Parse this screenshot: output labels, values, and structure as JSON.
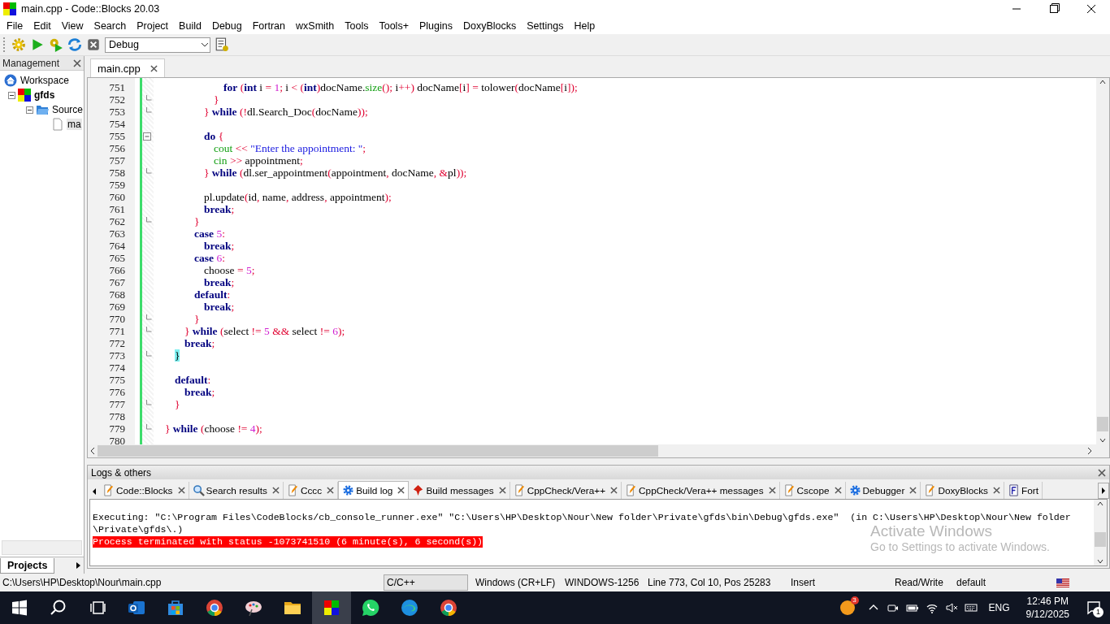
{
  "window": {
    "title": "main.cpp - Code::Blocks 20.03"
  },
  "menu": [
    "File",
    "Edit",
    "View",
    "Search",
    "Project",
    "Build",
    "Debug",
    "Fortran",
    "wxSmith",
    "Tools",
    "Tools+",
    "Plugins",
    "DoxyBlocks",
    "Settings",
    "Help"
  ],
  "toolbar": {
    "build_target": "Debug"
  },
  "management": {
    "title": "Management",
    "tree": [
      {
        "label": "Workspace",
        "kind": "workspace",
        "active": false,
        "selected": false,
        "children": [
          {
            "label": "gfds",
            "kind": "project",
            "active": true,
            "selected": false,
            "expanded": true,
            "children": [
              {
                "label": "Source",
                "kind": "folder",
                "active": false,
                "selected": false,
                "expanded": true,
                "children": [
                  {
                    "label": "ma",
                    "kind": "file",
                    "active": false,
                    "selected": true
                  }
                ]
              }
            ]
          }
        ]
      }
    ],
    "tabs": [
      {
        "label": "Projects",
        "selected": true
      }
    ]
  },
  "editor": {
    "tabs": [
      {
        "label": "main.cpp",
        "selected": true
      }
    ],
    "lines": [
      {
        "number": "751",
        "kind": "plain",
        "tokens": [
          {
            "kind": "kw",
            "text": "\t\t\t\t\t\tfor"
          },
          {
            "kind": "op",
            "text": " ("
          },
          {
            "kind": "kw",
            "text": "int"
          },
          {
            "kind": "id",
            "text": " i "
          },
          {
            "kind": "op",
            "text": "="
          },
          {
            "kind": "num",
            "text": " 1"
          },
          {
            "kind": "op",
            "text": ";"
          },
          {
            "kind": "id",
            "text": " i "
          },
          {
            "kind": "op",
            "text": "< ("
          },
          {
            "kind": "kw",
            "text": "int"
          },
          {
            "kind": "op",
            "text": ")"
          },
          {
            "kind": "id",
            "text": "docName."
          },
          {
            "kind": "lib",
            "text": "size"
          },
          {
            "kind": "op",
            "text": "();"
          },
          {
            "kind": "id",
            "text": " i"
          },
          {
            "kind": "op",
            "text": "++)"
          },
          {
            "kind": "id",
            "text": " docName"
          },
          {
            "kind": "op",
            "text": "["
          },
          {
            "kind": "id",
            "text": "i"
          },
          {
            "kind": "op",
            "text": "] ="
          },
          {
            "kind": "id",
            "text": " tolower"
          },
          {
            "kind": "op",
            "text": "("
          },
          {
            "kind": "id",
            "text": "docName"
          },
          {
            "kind": "op",
            "text": "["
          },
          {
            "kind": "id",
            "text": "i"
          },
          {
            "kind": "op",
            "text": "]);"
          }
        ]
      },
      {
        "number": "752",
        "kind": "fold-end",
        "tokens": [
          {
            "kind": "op",
            "text": "\t\t\t\t\t}"
          }
        ]
      },
      {
        "number": "753",
        "kind": "fold-end",
        "tokens": [
          {
            "kind": "op",
            "text": "\t\t\t\t}"
          },
          {
            "kind": "kw",
            "text": " while"
          },
          {
            "kind": "op",
            "text": " (!"
          },
          {
            "kind": "id",
            "text": "dl.Search_Doc"
          },
          {
            "kind": "op",
            "text": "("
          },
          {
            "kind": "id",
            "text": "docName"
          },
          {
            "kind": "op",
            "text": "));"
          }
        ]
      },
      {
        "number": "754",
        "kind": "plain"
      },
      {
        "number": "755",
        "kind": "fold-start",
        "tokens": [
          {
            "kind": "kw",
            "text": "\t\t\t\tdo"
          },
          {
            "kind": "op",
            "text": " {"
          }
        ]
      },
      {
        "number": "756",
        "kind": "plain",
        "tokens": [
          {
            "kind": "lib",
            "text": "\t\t\t\t\tcout"
          },
          {
            "kind": "op",
            "text": " <<"
          },
          {
            "kind": "str",
            "text": " \"Enter the appointment: \""
          },
          {
            "kind": "op",
            "text": ";"
          }
        ]
      },
      {
        "number": "757",
        "kind": "plain",
        "tokens": [
          {
            "kind": "lib",
            "text": "\t\t\t\t\tcin"
          },
          {
            "kind": "op",
            "text": " >>"
          },
          {
            "kind": "id",
            "text": " appointment"
          },
          {
            "kind": "op",
            "text": ";"
          }
        ]
      },
      {
        "number": "758",
        "kind": "fold-end",
        "tokens": [
          {
            "kind": "op",
            "text": "\t\t\t\t}"
          },
          {
            "kind": "kw",
            "text": " while"
          },
          {
            "kind": "op",
            "text": " ("
          },
          {
            "kind": "id",
            "text": "dl.ser_appointment"
          },
          {
            "kind": "op",
            "text": "("
          },
          {
            "kind": "id",
            "text": "appointment"
          },
          {
            "kind": "op",
            "text": ","
          },
          {
            "kind": "id",
            "text": " docName"
          },
          {
            "kind": "op",
            "text": ", &"
          },
          {
            "kind": "id",
            "text": "pl"
          },
          {
            "kind": "op",
            "text": "));"
          }
        ]
      },
      {
        "number": "759",
        "kind": "plain"
      },
      {
        "number": "760",
        "kind": "plain",
        "tokens": [
          {
            "kind": "id",
            "text": "\t\t\t\tpl.update"
          },
          {
            "kind": "op",
            "text": "("
          },
          {
            "kind": "id",
            "text": "id"
          },
          {
            "kind": "op",
            "text": ","
          },
          {
            "kind": "id",
            "text": " name"
          },
          {
            "kind": "op",
            "text": ","
          },
          {
            "kind": "id",
            "text": " address"
          },
          {
            "kind": "op",
            "text": ","
          },
          {
            "kind": "id",
            "text": " appointment"
          },
          {
            "kind": "op",
            "text": ");"
          }
        ]
      },
      {
        "number": "761",
        "kind": "plain",
        "tokens": [
          {
            "kind": "kw",
            "text": "\t\t\t\tbreak"
          },
          {
            "kind": "op",
            "text": ";"
          }
        ]
      },
      {
        "number": "762",
        "kind": "fold-end",
        "tokens": [
          {
            "kind": "op",
            "text": "\t\t\t}"
          }
        ]
      },
      {
        "number": "763",
        "kind": "plain",
        "tokens": [
          {
            "kind": "kw",
            "text": "\t\t\tcase"
          },
          {
            "kind": "num",
            "text": " 5"
          },
          {
            "kind": "op",
            "text": ":"
          }
        ]
      },
      {
        "number": "764",
        "kind": "plain",
        "tokens": [
          {
            "kind": "kw",
            "text": "\t\t\t\tbreak"
          },
          {
            "kind": "op",
            "text": ";"
          }
        ]
      },
      {
        "number": "765",
        "kind": "plain",
        "tokens": [
          {
            "kind": "kw",
            "text": "\t\t\tcase"
          },
          {
            "kind": "num",
            "text": " 6"
          },
          {
            "kind": "op",
            "text": ":"
          }
        ]
      },
      {
        "number": "766",
        "kind": "plain",
        "tokens": [
          {
            "kind": "id",
            "text": "\t\t\t\tchoose "
          },
          {
            "kind": "op",
            "text": "="
          },
          {
            "kind": "num",
            "text": " 5"
          },
          {
            "kind": "op",
            "text": ";"
          }
        ]
      },
      {
        "number": "767",
        "kind": "plain",
        "tokens": [
          {
            "kind": "kw",
            "text": "\t\t\t\tbreak"
          },
          {
            "kind": "op",
            "text": ";"
          }
        ]
      },
      {
        "number": "768",
        "kind": "plain",
        "tokens": [
          {
            "kind": "kw",
            "text": "\t\t\tdefault"
          },
          {
            "kind": "op",
            "text": ":"
          }
        ]
      },
      {
        "number": "769",
        "kind": "plain",
        "tokens": [
          {
            "kind": "kw",
            "text": "\t\t\t\tbreak"
          },
          {
            "kind": "op",
            "text": ";"
          }
        ]
      },
      {
        "number": "770",
        "kind": "fold-end",
        "tokens": [
          {
            "kind": "op",
            "text": "\t\t\t}"
          }
        ]
      },
      {
        "number": "771",
        "kind": "fold-end",
        "tokens": [
          {
            "kind": "op",
            "text": "\t\t}"
          },
          {
            "kind": "kw",
            "text": " while"
          },
          {
            "kind": "op",
            "text": " ("
          },
          {
            "kind": "id",
            "text": "select "
          },
          {
            "kind": "op",
            "text": "!="
          },
          {
            "kind": "num",
            "text": " 5"
          },
          {
            "kind": "op",
            "text": " &&"
          },
          {
            "kind": "id",
            "text": " select "
          },
          {
            "kind": "op",
            "text": "!="
          },
          {
            "kind": "num",
            "text": " 6"
          },
          {
            "kind": "op",
            "text": ");"
          }
        ]
      },
      {
        "number": "772",
        "kind": "plain",
        "tokens": [
          {
            "kind": "kw",
            "text": "\t\tbreak"
          },
          {
            "kind": "op",
            "text": ";"
          }
        ]
      },
      {
        "number": "773",
        "kind": "fold-end",
        "tokens": [
          {
            "kind": "match",
            "text": "\t}"
          }
        ]
      },
      {
        "number": "774",
        "kind": "plain"
      },
      {
        "number": "775",
        "kind": "plain",
        "tokens": [
          {
            "kind": "kw",
            "text": "\tdefault"
          },
          {
            "kind": "op",
            "text": ":"
          }
        ]
      },
      {
        "number": "776",
        "kind": "plain",
        "tokens": [
          {
            "kind": "kw",
            "text": "\t\tbreak"
          },
          {
            "kind": "op",
            "text": ";"
          }
        ]
      },
      {
        "number": "777",
        "kind": "fold-end",
        "tokens": [
          {
            "kind": "op",
            "text": "\t}"
          }
        ]
      },
      {
        "number": "778",
        "kind": "plain"
      },
      {
        "number": "779",
        "kind": "fold-end",
        "tokens": [
          {
            "kind": "op",
            "text": "}"
          },
          {
            "kind": "kw",
            "text": " while"
          },
          {
            "kind": "op",
            "text": " ("
          },
          {
            "kind": "id",
            "text": "choose "
          },
          {
            "kind": "op",
            "text": "!="
          },
          {
            "kind": "num",
            "text": " 4"
          },
          {
            "kind": "op",
            "text": ");"
          }
        ]
      },
      {
        "number": "780",
        "kind": "plain"
      }
    ]
  },
  "logs": {
    "title": "Logs & others",
    "tabs": [
      {
        "label": "Code::Blocks",
        "kind": "pencil",
        "selected": false
      },
      {
        "label": "Search results",
        "kind": "search",
        "selected": false
      },
      {
        "label": "Cccc",
        "kind": "pencil",
        "selected": false
      },
      {
        "label": "Build log",
        "kind": "gear",
        "selected": true
      },
      {
        "label": "Build messages",
        "kind": "marker",
        "selected": false
      },
      {
        "label": "CppCheck/Vera++",
        "kind": "pencil",
        "selected": false
      },
      {
        "label": "CppCheck/Vera++ messages",
        "kind": "pencil",
        "selected": false
      },
      {
        "label": "Cscope",
        "kind": "pencil",
        "selected": false
      },
      {
        "label": "Debugger",
        "kind": "gear",
        "selected": false
      },
      {
        "label": "DoxyBlocks",
        "kind": "pencil",
        "selected": false
      },
      {
        "label": "Fort",
        "kind": "document",
        "selected": false
      }
    ],
    "lines": [
      {
        "kind": "normal",
        "text": "Executing: \"C:\\Program Files\\CodeBlocks/cb_console_runner.exe\" \"C:\\Users\\HP\\Desktop\\Nour\\New folder\\Private\\gfds\\bin\\Debug\\gfds.exe\"  (in C:\\Users\\HP\\Desktop\\Nour\\New folder"
      },
      {
        "kind": "normal",
        "text": "\\Private\\gfds\\.)"
      },
      {
        "kind": "error",
        "text": "Process terminated with status -1073741510 (6 minute(s), 6 second(s))"
      }
    ]
  },
  "activation_notice": {
    "title": "Activate Windows",
    "text": "Go to Settings to activate Windows."
  },
  "status_bar": {
    "path": "C:\\Users\\HP\\Desktop\\Nour\\main.cpp",
    "language": "C/C++",
    "line_endings": "Windows (CR+LF)",
    "encoding": "WINDOWS-1256",
    "position": "Line 773, Col 10, Pos 25283",
    "mode": "Insert",
    "access": "Read/Write",
    "profile": "default"
  },
  "taskbar": {
    "apps": [
      {
        "kind": "mail",
        "selected": false
      },
      {
        "kind": "store",
        "selected": false
      },
      {
        "kind": "browser",
        "selected": false
      },
      {
        "kind": "paint",
        "selected": false
      },
      {
        "kind": "folder",
        "selected": false
      },
      {
        "kind": "ide",
        "selected": true
      },
      {
        "kind": "chat",
        "selected": false
      },
      {
        "kind": "edge",
        "selected": false
      },
      {
        "kind": "browser",
        "selected": false
      }
    ],
    "weather_badge": "3",
    "language": "ENG",
    "time": "12:46 PM",
    "date": "9/12/2025",
    "notifications": "1"
  }
}
